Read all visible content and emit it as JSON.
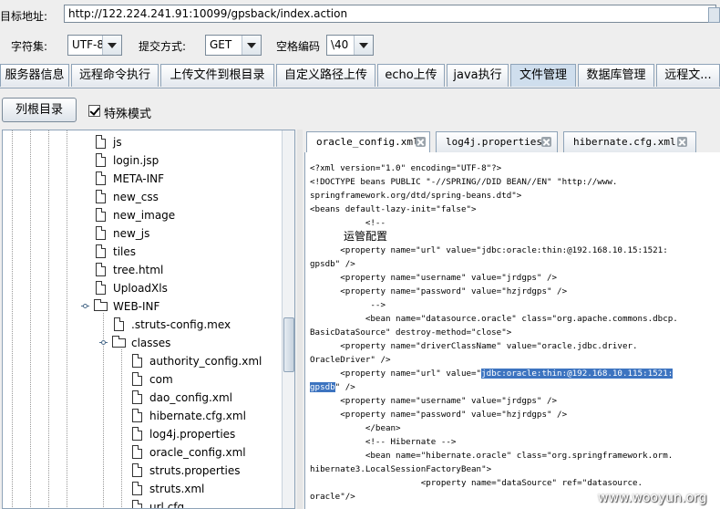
{
  "url_bar": {
    "label": "目标地址:",
    "value": "http://122.224.241.91:10099/gpsback/index.action"
  },
  "options": {
    "charset_label": "字符集:",
    "charset_value": "UTF-8",
    "method_label": "提交方式:",
    "method_value": "GET",
    "space_label": "空格编码",
    "space_value": "\\40"
  },
  "main_tabs": [
    {
      "label": "服务器信息"
    },
    {
      "label": "远程命令执行"
    },
    {
      "label": "上传文件到根目录"
    },
    {
      "label": "自定义路径上传"
    },
    {
      "label": "echo上传"
    },
    {
      "label": "java执行"
    },
    {
      "label": "文件管理",
      "active": true
    },
    {
      "label": "数据库管理"
    },
    {
      "label": "远程文..."
    }
  ],
  "toolbar": {
    "list_root_label": "列根目录",
    "special_mode_label": "特殊模式",
    "special_mode_checked": true
  },
  "tree": [
    {
      "label": "js",
      "type": "file"
    },
    {
      "label": "login.jsp",
      "type": "file"
    },
    {
      "label": "META-INF",
      "type": "file"
    },
    {
      "label": "new_css",
      "type": "file"
    },
    {
      "label": "new_image",
      "type": "file"
    },
    {
      "label": "new_js",
      "type": "file"
    },
    {
      "label": "tiles",
      "type": "file"
    },
    {
      "label": "tree.html",
      "type": "file"
    },
    {
      "label": "UploadXls",
      "type": "file"
    },
    {
      "label": "WEB-INF",
      "type": "folder"
    },
    {
      "label": ".struts-config.mex",
      "type": "file"
    },
    {
      "label": "classes",
      "type": "folder"
    },
    {
      "label": "authority_config.xml",
      "type": "file"
    },
    {
      "label": "com",
      "type": "file"
    },
    {
      "label": "dao_config.xml",
      "type": "file"
    },
    {
      "label": "hibernate.cfg.xml",
      "type": "file"
    },
    {
      "label": "log4j.properties",
      "type": "file"
    },
    {
      "label": "oracle_config.xml",
      "type": "file"
    },
    {
      "label": "struts.properties",
      "type": "file"
    },
    {
      "label": "struts.xml",
      "type": "file"
    },
    {
      "label": "url.cfg",
      "type": "file"
    }
  ],
  "editor_tabs": [
    {
      "label": "oracle_config.xml",
      "active": true
    },
    {
      "label": "log4j.properties"
    },
    {
      "label": "hibernate.cfg.xml"
    }
  ],
  "editor_lines": [
    "<?xml version=\"1.0\" encoding=\"UTF-8\"?>",
    "<!DOCTYPE beans PUBLIC \"-//SPRING//DID BEAN//EN\" \"http://www.",
    "springframework.org/dtd/spring-beans.dtd\">",
    "<beans default-lazy-init=\"false\">",
    "           <!--",
    "运管配置",
    "      <property name=\"url\" value=\"jdbc:oracle:thin:@192.168.10.15:1521:",
    "gpsdb\" />",
    "      <property name=\"username\" value=\"jrdgps\" />",
    "      <property name=\"password\" value=\"hzjrdgps\" />",
    "            -->",
    "           <bean name=\"datasource.oracle\" class=\"org.apache.commons.dbcp.",
    "BasicDataSource\" destroy-method=\"close\">",
    "      <property name=\"driverClassName\" value=\"oracle.jdbc.driver.",
    "OracleDriver\" />",
    "      <property name=\"url\" value=\"",
    "jdbc:oracle:thin:@192.168.10.115:1521:",
    "gpsdb",
    "\" />",
    "      <property name=\"username\" value=\"jrdgps\" />",
    "      <property name=\"password\" value=\"hzjrdgps\" />",
    "           </bean>",
    "           <!-- Hibernate -->",
    "           <bean name=\"hibernate.oracle\" class=\"org.springframework.orm.",
    "hibernate3.LocalSessionFactoryBean\">",
    "                      <property name=\"dataSource\" ref=\"datasource.",
    "oracle\"/>"
  ],
  "watermark": "www.wooyun.org"
}
